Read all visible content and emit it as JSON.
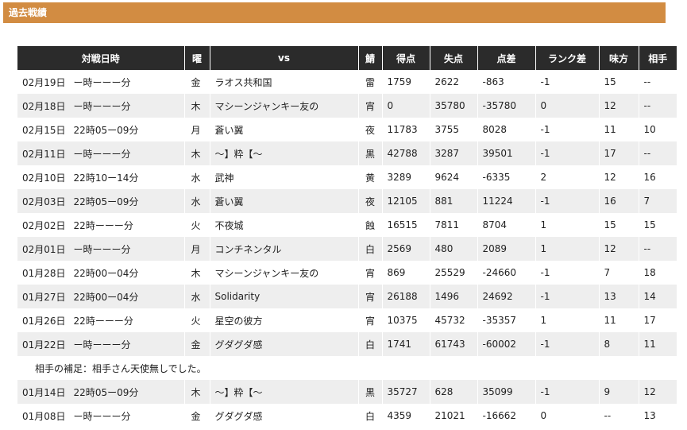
{
  "section": {
    "title": "過去戦績"
  },
  "table": {
    "headers": [
      "対戦日時",
      "曜",
      "vs",
      "鯖",
      "得点",
      "失点",
      "点差",
      "ランク差",
      "味方",
      "相手"
    ],
    "rows": [
      {
        "date": "02月19日",
        "time": "ー時ーーー分",
        "dow": "金",
        "vs": "ラオス共和国",
        "server": "雷",
        "score": "1759",
        "lost": "2622",
        "diff": "-863",
        "rank": "-1",
        "ally": "15",
        "enemy": "--"
      },
      {
        "date": "02月18日",
        "time": "ー時ーーー分",
        "dow": "木",
        "vs": "マシーンジャンキー友の",
        "server": "宵",
        "score": "0",
        "lost": "35780",
        "diff": "-35780",
        "rank": "0",
        "ally": "12",
        "enemy": "--"
      },
      {
        "date": "02月15日",
        "time": "22時05ー09分",
        "dow": "月",
        "vs": "蒼い翼",
        "server": "夜",
        "score": "11783",
        "lost": "3755",
        "diff": "8028",
        "rank": "-1",
        "ally": "11",
        "enemy": "10"
      },
      {
        "date": "02月11日",
        "time": "ー時ーーー分",
        "dow": "木",
        "vs": "〜】粋【〜",
        "server": "黒",
        "score": "42788",
        "lost": "3287",
        "diff": "39501",
        "rank": "-1",
        "ally": "17",
        "enemy": "--"
      },
      {
        "date": "02月10日",
        "time": "22時10ー14分",
        "dow": "水",
        "vs": "武神",
        "server": "黄",
        "score": "3289",
        "lost": "9624",
        "diff": "-6335",
        "rank": "2",
        "ally": "12",
        "enemy": "16"
      },
      {
        "date": "02月03日",
        "time": "22時05ー09分",
        "dow": "水",
        "vs": "蒼い翼",
        "server": "夜",
        "score": "12105",
        "lost": "881",
        "diff": "11224",
        "rank": "-1",
        "ally": "16",
        "enemy": "7"
      },
      {
        "date": "02月02日",
        "time": "22時ーーー分",
        "dow": "火",
        "vs": "不夜城",
        "server": "蝕",
        "score": "16515",
        "lost": "7811",
        "diff": "8704",
        "rank": "1",
        "ally": "15",
        "enemy": "15"
      },
      {
        "date": "02月01日",
        "time": "ー時ーーー分",
        "dow": "月",
        "vs": "コンチネンタル",
        "server": "白",
        "score": "2569",
        "lost": "480",
        "diff": "2089",
        "rank": "1",
        "ally": "12",
        "enemy": "--"
      },
      {
        "date": "01月28日",
        "time": "22時00ー04分",
        "dow": "木",
        "vs": "マシーンジャンキー友の",
        "server": "宵",
        "score": "869",
        "lost": "25529",
        "diff": "-24660",
        "rank": "-1",
        "ally": "7",
        "enemy": "18"
      },
      {
        "date": "01月27日",
        "time": "22時00ー04分",
        "dow": "水",
        "vs": "Solidarity",
        "server": "宵",
        "score": "26188",
        "lost": "1496",
        "diff": "24692",
        "rank": "-1",
        "ally": "13",
        "enemy": "14"
      },
      {
        "date": "01月26日",
        "time": "22時ーーー分",
        "dow": "火",
        "vs": "星空の彼方",
        "server": "宵",
        "score": "10375",
        "lost": "45732",
        "diff": "-35357",
        "rank": "1",
        "ally": "11",
        "enemy": "17"
      },
      {
        "date": "01月22日",
        "time": "ー時ーーー分",
        "dow": "金",
        "vs": "グダグダ感",
        "server": "白",
        "score": "1741",
        "lost": "61743",
        "diff": "-60002",
        "rank": "-1",
        "ally": "8",
        "enemy": "11"
      }
    ],
    "note": "相手の補足：相手さん天使無しでした。",
    "rows_after": [
      {
        "date": "01月14日",
        "time": "22時05ー09分",
        "dow": "木",
        "vs": "〜】粋【〜",
        "server": "黒",
        "score": "35727",
        "lost": "628",
        "diff": "35099",
        "rank": "-1",
        "ally": "9",
        "enemy": "12"
      },
      {
        "date": "01月08日",
        "time": "ー時ーーー分",
        "dow": "金",
        "vs": "グダグダ感",
        "server": "白",
        "score": "4359",
        "lost": "21021",
        "diff": "-16662",
        "rank": "0",
        "ally": "--",
        "enemy": "13"
      }
    ]
  },
  "colors": {
    "header_bar": "#d28c42",
    "table_header": "#2b2b2b",
    "row_alt": "#eeeeee"
  }
}
